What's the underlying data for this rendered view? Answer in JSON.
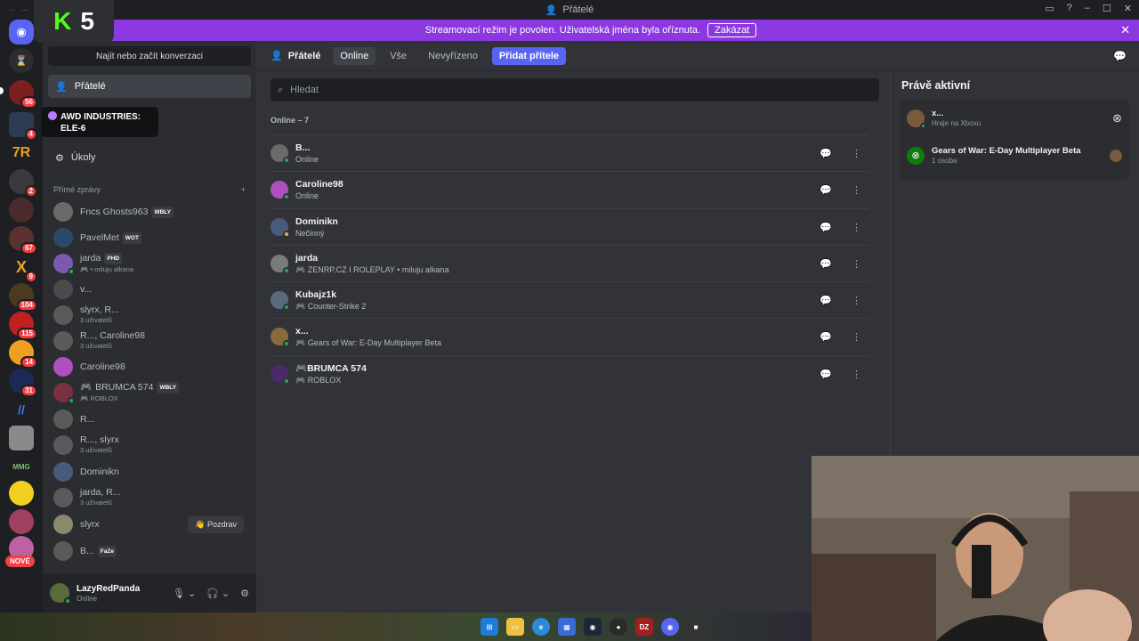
{
  "window": {
    "title": "Přátelé",
    "nav": "← →"
  },
  "banner": {
    "text": "Streamovací režim je povolen. Uživatelská jména byla oříznuta.",
    "button": "Zakázat",
    "close": "✕"
  },
  "overlay": {
    "k": "K",
    "five": "5"
  },
  "rail": {
    "badges": [
      "56",
      "4",
      "2",
      "67",
      "9",
      "104",
      "115",
      "14",
      "31"
    ],
    "new_label": "NOVÉ",
    "colors": {
      "discord": "#5865f2"
    }
  },
  "sidebar": {
    "search_placeholder": "Najít nebo začít konverzaci",
    "friends_label": "Přátelé",
    "tooltip_line1": "AWD INDUSTRIES:",
    "tooltip_line2": "ELE-6",
    "tasks_label": "Úkoly",
    "dm_header": "Přímé zprávy",
    "dm_add": "+",
    "dms": [
      {
        "name": "Fncs Ghosts963",
        "tag": "WBLY",
        "sub": ""
      },
      {
        "name": "PavelMet",
        "tag": "WOT",
        "sub": ""
      },
      {
        "name": "jarda",
        "tag": "PHD",
        "sub": "• miluju alkana"
      },
      {
        "name": "v...",
        "tag": "",
        "sub": ""
      },
      {
        "name": "slyrx, R...",
        "tag": "",
        "sub": "3 uživatelů"
      },
      {
        "name": "R..., Caroline98",
        "tag": "",
        "sub": "3 uživatelů"
      },
      {
        "name": "Caroline98",
        "tag": "",
        "sub": ""
      },
      {
        "name": "BRUMCA 574",
        "tag": "WBLY",
        "sub": "ROBLOX"
      },
      {
        "name": "R...",
        "tag": "",
        "sub": ""
      },
      {
        "name": "R..., slyrx",
        "tag": "",
        "sub": "3 uživatelů"
      },
      {
        "name": "Dominikn",
        "tag": "",
        "sub": ""
      },
      {
        "name": "jarda, R...",
        "tag": "",
        "sub": "3 uživatelů"
      },
      {
        "name": "slyrx",
        "tag": "",
        "sub": ""
      },
      {
        "name": "B...",
        "tag": "FaZe",
        "sub": ""
      }
    ],
    "pozdrav": "👋 Pozdrav"
  },
  "user": {
    "name": "LazyRedPanda",
    "status": "Online"
  },
  "main": {
    "title": "Přátelé",
    "tabs": [
      "Online",
      "Vše",
      "Nevyřízeno"
    ],
    "add_friend": "Přidat přítele",
    "search_placeholder": "Hledat",
    "online_count": "Online – 7",
    "friends": [
      {
        "name": "B...",
        "status": "Online",
        "idle": false
      },
      {
        "name": "Caroline98",
        "status": "Online",
        "idle": false
      },
      {
        "name": "Dominikn",
        "status": "Nečinný",
        "idle": true
      },
      {
        "name": "jarda",
        "status": "ZENRP.CZ I ROLEPLAY • miluju alkana",
        "idle": false
      },
      {
        "name": "Kubajz1k",
        "status": "Counter-Strike 2",
        "idle": false
      },
      {
        "name": "x...",
        "status": "Gears of War: E-Day Multiplayer Beta",
        "idle": false
      },
      {
        "name": "BRUMCA 574",
        "status": "ROBLOX",
        "idle": false
      }
    ]
  },
  "active_now": {
    "title": "Právě aktivní",
    "user_name": "x...",
    "user_status": "Hraje na Xboxu",
    "game_name": "Gears of War: E-Day Multiplayer Beta",
    "game_count": "1 osoba"
  },
  "taskbar": {
    "icons": [
      "windows-icon",
      "explorer-icon",
      "edge-icon",
      "store-icon",
      "steam-icon",
      "obs-icon",
      "dz-icon",
      "discord-icon",
      "app-icon"
    ]
  }
}
